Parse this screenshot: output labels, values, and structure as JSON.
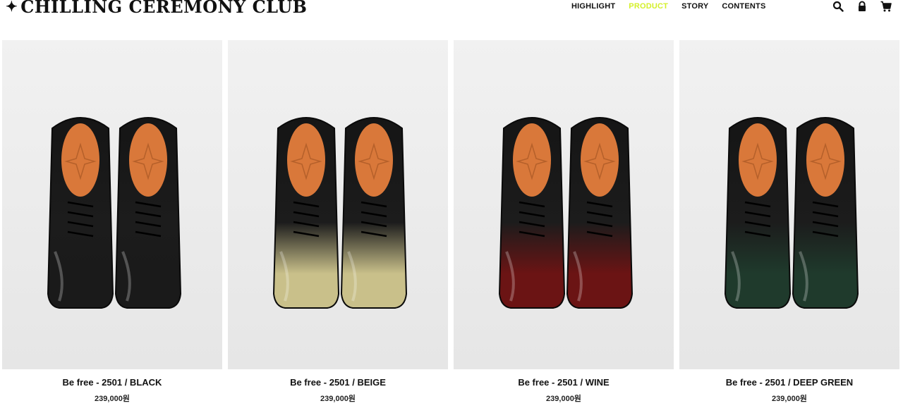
{
  "brand": {
    "star": "✦",
    "name": "CHILLING CEREMONY CLUB"
  },
  "nav": [
    {
      "label": "HIGHLIGHT",
      "active": false
    },
    {
      "label": "PRODUCT",
      "active": true
    },
    {
      "label": "STORY",
      "active": false
    },
    {
      "label": "CONTENTS",
      "active": false
    }
  ],
  "icons": [
    "search-icon",
    "lock-icon",
    "cart-icon"
  ],
  "colors": {
    "active_nav": "#d4f02a",
    "insole": "#d9783a"
  },
  "products": [
    {
      "name": "Be free - 2501 / BLACK",
      "price": "239,000원",
      "tint": "#1a1a1a"
    },
    {
      "name": "Be free - 2501 / BEIGE",
      "price": "239,000원",
      "tint": "#c9c08a"
    },
    {
      "name": "Be free - 2501 / WINE",
      "price": "239,000원",
      "tint": "#6b1414"
    },
    {
      "name": "Be free - 2501 / DEEP GREEN",
      "price": "239,000원",
      "tint": "#1f3a2c"
    }
  ]
}
